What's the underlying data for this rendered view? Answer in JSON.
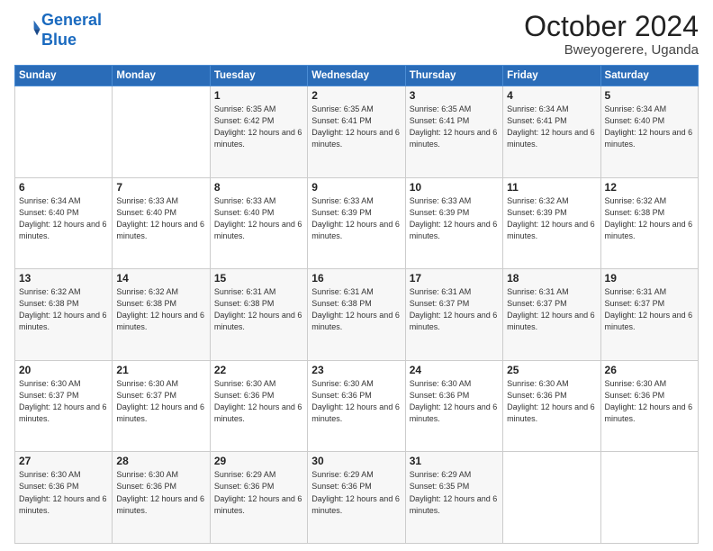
{
  "header": {
    "logo_line1": "General",
    "logo_line2": "Blue",
    "month": "October 2024",
    "location": "Bweyogerere, Uganda"
  },
  "weekdays": [
    "Sunday",
    "Monday",
    "Tuesday",
    "Wednesday",
    "Thursday",
    "Friday",
    "Saturday"
  ],
  "weeks": [
    [
      {
        "day": "",
        "sunrise": "",
        "sunset": "",
        "daylight": ""
      },
      {
        "day": "",
        "sunrise": "",
        "sunset": "",
        "daylight": ""
      },
      {
        "day": "1",
        "sunrise": "Sunrise: 6:35 AM",
        "sunset": "Sunset: 6:42 PM",
        "daylight": "Daylight: 12 hours and 6 minutes."
      },
      {
        "day": "2",
        "sunrise": "Sunrise: 6:35 AM",
        "sunset": "Sunset: 6:41 PM",
        "daylight": "Daylight: 12 hours and 6 minutes."
      },
      {
        "day": "3",
        "sunrise": "Sunrise: 6:35 AM",
        "sunset": "Sunset: 6:41 PM",
        "daylight": "Daylight: 12 hours and 6 minutes."
      },
      {
        "day": "4",
        "sunrise": "Sunrise: 6:34 AM",
        "sunset": "Sunset: 6:41 PM",
        "daylight": "Daylight: 12 hours and 6 minutes."
      },
      {
        "day": "5",
        "sunrise": "Sunrise: 6:34 AM",
        "sunset": "Sunset: 6:40 PM",
        "daylight": "Daylight: 12 hours and 6 minutes."
      }
    ],
    [
      {
        "day": "6",
        "sunrise": "Sunrise: 6:34 AM",
        "sunset": "Sunset: 6:40 PM",
        "daylight": "Daylight: 12 hours and 6 minutes."
      },
      {
        "day": "7",
        "sunrise": "Sunrise: 6:33 AM",
        "sunset": "Sunset: 6:40 PM",
        "daylight": "Daylight: 12 hours and 6 minutes."
      },
      {
        "day": "8",
        "sunrise": "Sunrise: 6:33 AM",
        "sunset": "Sunset: 6:40 PM",
        "daylight": "Daylight: 12 hours and 6 minutes."
      },
      {
        "day": "9",
        "sunrise": "Sunrise: 6:33 AM",
        "sunset": "Sunset: 6:39 PM",
        "daylight": "Daylight: 12 hours and 6 minutes."
      },
      {
        "day": "10",
        "sunrise": "Sunrise: 6:33 AM",
        "sunset": "Sunset: 6:39 PM",
        "daylight": "Daylight: 12 hours and 6 minutes."
      },
      {
        "day": "11",
        "sunrise": "Sunrise: 6:32 AM",
        "sunset": "Sunset: 6:39 PM",
        "daylight": "Daylight: 12 hours and 6 minutes."
      },
      {
        "day": "12",
        "sunrise": "Sunrise: 6:32 AM",
        "sunset": "Sunset: 6:38 PM",
        "daylight": "Daylight: 12 hours and 6 minutes."
      }
    ],
    [
      {
        "day": "13",
        "sunrise": "Sunrise: 6:32 AM",
        "sunset": "Sunset: 6:38 PM",
        "daylight": "Daylight: 12 hours and 6 minutes."
      },
      {
        "day": "14",
        "sunrise": "Sunrise: 6:32 AM",
        "sunset": "Sunset: 6:38 PM",
        "daylight": "Daylight: 12 hours and 6 minutes."
      },
      {
        "day": "15",
        "sunrise": "Sunrise: 6:31 AM",
        "sunset": "Sunset: 6:38 PM",
        "daylight": "Daylight: 12 hours and 6 minutes."
      },
      {
        "day": "16",
        "sunrise": "Sunrise: 6:31 AM",
        "sunset": "Sunset: 6:38 PM",
        "daylight": "Daylight: 12 hours and 6 minutes."
      },
      {
        "day": "17",
        "sunrise": "Sunrise: 6:31 AM",
        "sunset": "Sunset: 6:37 PM",
        "daylight": "Daylight: 12 hours and 6 minutes."
      },
      {
        "day": "18",
        "sunrise": "Sunrise: 6:31 AM",
        "sunset": "Sunset: 6:37 PM",
        "daylight": "Daylight: 12 hours and 6 minutes."
      },
      {
        "day": "19",
        "sunrise": "Sunrise: 6:31 AM",
        "sunset": "Sunset: 6:37 PM",
        "daylight": "Daylight: 12 hours and 6 minutes."
      }
    ],
    [
      {
        "day": "20",
        "sunrise": "Sunrise: 6:30 AM",
        "sunset": "Sunset: 6:37 PM",
        "daylight": "Daylight: 12 hours and 6 minutes."
      },
      {
        "day": "21",
        "sunrise": "Sunrise: 6:30 AM",
        "sunset": "Sunset: 6:37 PM",
        "daylight": "Daylight: 12 hours and 6 minutes."
      },
      {
        "day": "22",
        "sunrise": "Sunrise: 6:30 AM",
        "sunset": "Sunset: 6:36 PM",
        "daylight": "Daylight: 12 hours and 6 minutes."
      },
      {
        "day": "23",
        "sunrise": "Sunrise: 6:30 AM",
        "sunset": "Sunset: 6:36 PM",
        "daylight": "Daylight: 12 hours and 6 minutes."
      },
      {
        "day": "24",
        "sunrise": "Sunrise: 6:30 AM",
        "sunset": "Sunset: 6:36 PM",
        "daylight": "Daylight: 12 hours and 6 minutes."
      },
      {
        "day": "25",
        "sunrise": "Sunrise: 6:30 AM",
        "sunset": "Sunset: 6:36 PM",
        "daylight": "Daylight: 12 hours and 6 minutes."
      },
      {
        "day": "26",
        "sunrise": "Sunrise: 6:30 AM",
        "sunset": "Sunset: 6:36 PM",
        "daylight": "Daylight: 12 hours and 6 minutes."
      }
    ],
    [
      {
        "day": "27",
        "sunrise": "Sunrise: 6:30 AM",
        "sunset": "Sunset: 6:36 PM",
        "daylight": "Daylight: 12 hours and 6 minutes."
      },
      {
        "day": "28",
        "sunrise": "Sunrise: 6:30 AM",
        "sunset": "Sunset: 6:36 PM",
        "daylight": "Daylight: 12 hours and 6 minutes."
      },
      {
        "day": "29",
        "sunrise": "Sunrise: 6:29 AM",
        "sunset": "Sunset: 6:36 PM",
        "daylight": "Daylight: 12 hours and 6 minutes."
      },
      {
        "day": "30",
        "sunrise": "Sunrise: 6:29 AM",
        "sunset": "Sunset: 6:36 PM",
        "daylight": "Daylight: 12 hours and 6 minutes."
      },
      {
        "day": "31",
        "sunrise": "Sunrise: 6:29 AM",
        "sunset": "Sunset: 6:35 PM",
        "daylight": "Daylight: 12 hours and 6 minutes."
      },
      {
        "day": "",
        "sunrise": "",
        "sunset": "",
        "daylight": ""
      },
      {
        "day": "",
        "sunrise": "",
        "sunset": "",
        "daylight": ""
      }
    ]
  ]
}
